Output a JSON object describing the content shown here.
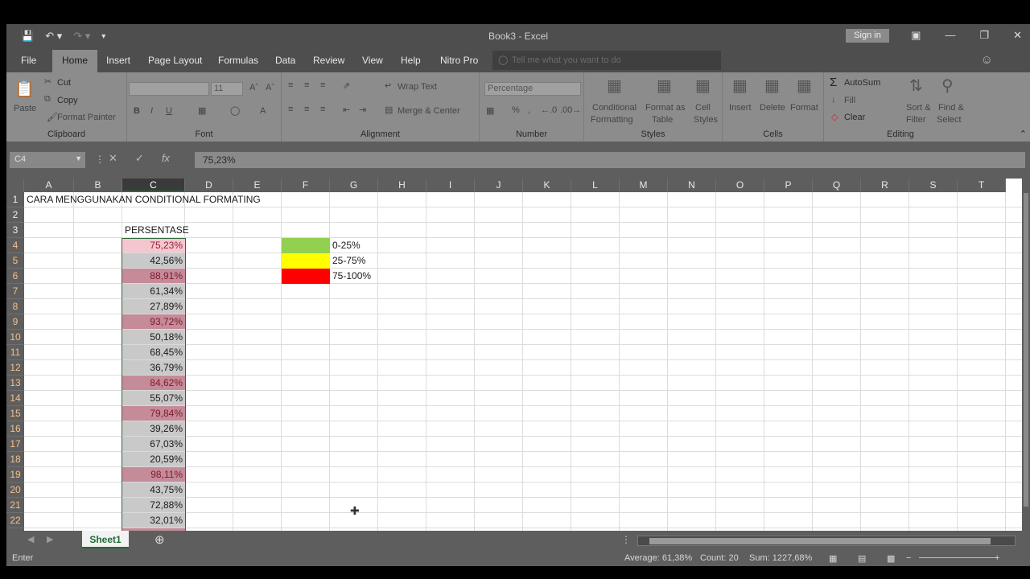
{
  "window": {
    "title": "Book3  -  Excel",
    "sign_in": "Sign in"
  },
  "tabs": [
    "File",
    "Home",
    "Insert",
    "Page Layout",
    "Formulas",
    "Data",
    "Review",
    "View",
    "Help",
    "Nitro Pro"
  ],
  "tell_me_placeholder": "Tell me what you want to do",
  "ribbon": {
    "clipboard": {
      "label": "Clipboard",
      "paste": "Paste",
      "cut": "Cut",
      "copy": "Copy",
      "format_painter": "Format Painter"
    },
    "font": {
      "label": "Font",
      "size": "11"
    },
    "alignment": {
      "label": "Alignment",
      "wrap_text": "Wrap Text",
      "merge_center": "Merge & Center"
    },
    "number": {
      "label": "Number",
      "format": "Percentage"
    },
    "styles": {
      "label": "Styles",
      "cond1": "Conditional",
      "cond2": "Formatting",
      "fmt1": "Format as",
      "fmt2": "Table",
      "cell1": "Cell",
      "cell2": "Styles"
    },
    "cells": {
      "label": "Cells",
      "insert": "Insert",
      "delete": "Delete",
      "format": "Format"
    },
    "editing": {
      "label": "Editing",
      "autosum": "AutoSum",
      "fill": "Fill",
      "clear": "Clear",
      "sort1": "Sort &",
      "sort2": "Filter",
      "find1": "Find &",
      "find2": "Select"
    }
  },
  "formula_bar": {
    "name_box": "C4",
    "value": "75,23%"
  },
  "columns": [
    "A",
    "B",
    "C",
    "D",
    "E",
    "F",
    "G",
    "H",
    "I",
    "J",
    "K",
    "L",
    "M",
    "N",
    "O",
    "P",
    "Q",
    "R",
    "S",
    "T"
  ],
  "rows": [
    "1",
    "2",
    "3",
    "4",
    "5",
    "6",
    "7",
    "8",
    "9",
    "10",
    "11",
    "12",
    "13",
    "14",
    "15",
    "16",
    "17",
    "18",
    "19",
    "20",
    "21",
    "22"
  ],
  "cells": {
    "a1": "CARA MENGGUNAKAN CONDITIONAL FORMATING",
    "c3": "PERSENTASE",
    "g4": "0-25%",
    "g5": "25-75%",
    "g6": "75-100%"
  },
  "percent_values": [
    "75,23%",
    "42,56%",
    "88,91%",
    "61,34%",
    "27,89%",
    "93,72%",
    "50,18%",
    "68,45%",
    "36,79%",
    "84,62%",
    "55,07%",
    "79,84%",
    "39,26%",
    "67,03%",
    "20,59%",
    "98,11%",
    "43,75%",
    "72,88%",
    "32,01%"
  ],
  "legend_colors": [
    "#92d050",
    "#ffff00",
    "#ff0000"
  ],
  "sheet_tab": "Sheet1",
  "status": {
    "mode": "Enter",
    "average": "Average: 61,38%",
    "count": "Count: 20",
    "sum": "Sum: 1227,68%"
  }
}
